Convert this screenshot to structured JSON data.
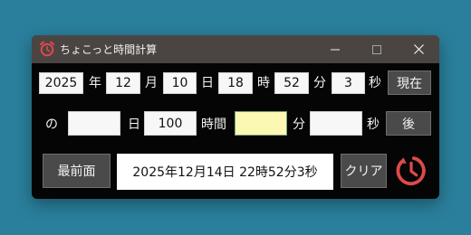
{
  "window": {
    "title": "ちょこっと時間計算"
  },
  "row1": {
    "year": "2025",
    "year_label": "年",
    "month": "12",
    "month_label": "月",
    "day": "10",
    "day_label": "日",
    "hour": "18",
    "hour_label": "時",
    "minute": "52",
    "minute_label": "分",
    "second": "3",
    "second_label": "秒",
    "now_button": "現在"
  },
  "row2": {
    "prefix_label": "の",
    "days": "",
    "days_label": "日",
    "hours": "100",
    "hours_label": "時間",
    "minutes": "",
    "minutes_label": "分",
    "seconds": "",
    "seconds_label": "秒",
    "after_button": "後"
  },
  "row3": {
    "topmost_button": "最前面",
    "result": "2025年12月14日 22時52分3秒",
    "clear_button": "クリア"
  },
  "icons": {
    "app": "alarm-clock-icon",
    "minimize": "minimize-icon",
    "maximize": "maximize-icon",
    "close": "close-icon",
    "clock": "clock-rotate-icon"
  },
  "colors": {
    "accent_red": "#e0494b",
    "active_field": "#fbf8b4",
    "background": "#2a7f9c"
  }
}
